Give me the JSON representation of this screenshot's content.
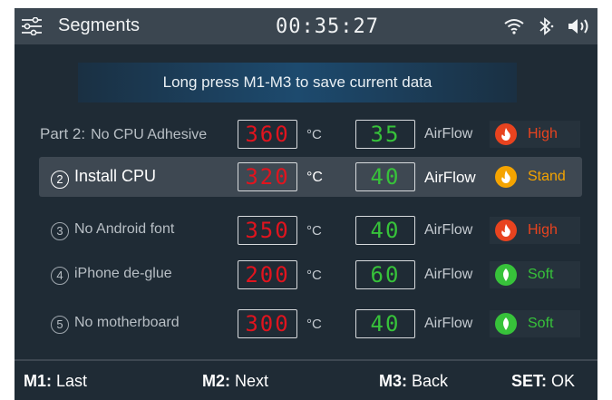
{
  "status": {
    "title": "Segments",
    "clock": "00:35:27",
    "icons": [
      "sliders-icon",
      "wifi-icon",
      "bluetooth-icon",
      "volume-icon"
    ]
  },
  "banner": "Long press M1-M3 to save current data",
  "temp_unit": "°C",
  "airflow_label": "AirFlow",
  "rows": [
    {
      "prefix": "Part 2:",
      "index": "",
      "label": "No CPU Adhesive",
      "temperature": "360",
      "airflow": "35",
      "mode": "High",
      "mode_color": "#e8431f",
      "selected": false
    },
    {
      "prefix": "",
      "index": "2",
      "label": "Install CPU",
      "temperature": "320",
      "airflow": "40",
      "mode": "Stand",
      "mode_color": "#f5a400",
      "selected": true
    },
    {
      "prefix": "",
      "index": "3",
      "label": "No Android font",
      "temperature": "350",
      "airflow": "40",
      "mode": "High",
      "mode_color": "#e8431f",
      "selected": false
    },
    {
      "prefix": "",
      "index": "4",
      "label": "iPhone de-glue",
      "temperature": "200",
      "airflow": "60",
      "mode": "Soft",
      "mode_color": "#37c23a",
      "selected": false
    },
    {
      "prefix": "",
      "index": "5",
      "label": "No motherboard",
      "temperature": "300",
      "airflow": "40",
      "mode": "Soft",
      "mode_color": "#37c23a",
      "selected": false
    }
  ],
  "footer": [
    {
      "key": "M1:",
      "action": "Last"
    },
    {
      "key": "M2:",
      "action": "Next"
    },
    {
      "key": "M3:",
      "action": "Back"
    },
    {
      "key": "SET:",
      "action": "OK"
    }
  ],
  "colors": {
    "temperature": "#e0141e",
    "airflow": "#37c23a",
    "background": "#1f2b35"
  }
}
